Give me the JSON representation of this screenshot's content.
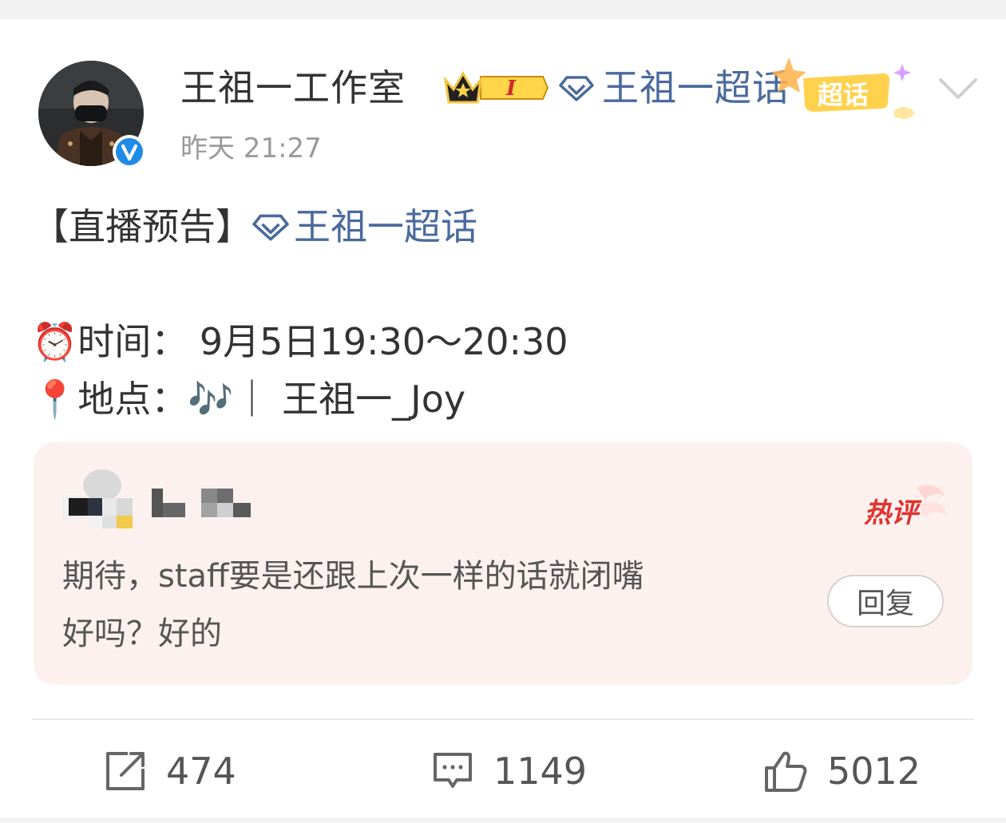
{
  "post": {
    "author": "王祖一工作室",
    "time": "昨天 21:27",
    "header_topic": "王祖一超话",
    "badge_text": "超话",
    "content": {
      "prefix": "【直播预告】",
      "topic": "王祖一超话",
      "time_line": "⏰时间：  9月5日19:30～20:30",
      "place_line": "📍地点：🎶｜ 王祖一_Joy"
    }
  },
  "hot_comment": {
    "tag": "热评",
    "text_line1": "期待，staff要是还跟上次一样的话就闭嘴",
    "text_line2": "好吗？好的",
    "reply_label": "回复"
  },
  "actions": {
    "repost_count": "474",
    "comment_count": "1149",
    "like_count": "5012"
  },
  "colors": {
    "topic_blue": "#4a6a9c",
    "hot_red": "#e0332f",
    "comment_bg": "#fdf1ef",
    "verified_blue": "#1f8be6"
  },
  "icons": [
    "verified-icon",
    "crown-icon",
    "diamond-icon",
    "chevron-down-icon",
    "repost-icon",
    "comment-icon",
    "like-icon"
  ]
}
